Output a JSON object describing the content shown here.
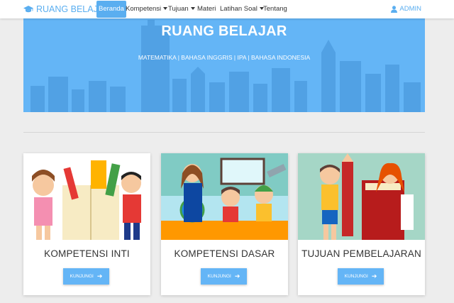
{
  "brand": {
    "name": "RUANG BELAJAR",
    "icon": "graduation-cap-icon"
  },
  "nav": {
    "items": [
      {
        "label": "Beranda",
        "active": true,
        "dropdown": false
      },
      {
        "label": "Kompetensi",
        "active": false,
        "dropdown": true
      },
      {
        "label": "Tujuan",
        "active": false,
        "dropdown": true
      },
      {
        "label": "Materi",
        "active": false,
        "dropdown": false
      },
      {
        "label": "Latihan Soal",
        "active": false,
        "dropdown": true
      },
      {
        "label": "Tentang",
        "active": false,
        "dropdown": false
      }
    ],
    "user": {
      "label": "ADMIN",
      "icon": "user-icon"
    }
  },
  "hero": {
    "title": "RUANG BELAJAR",
    "subtitle": "MATEMATIKA | BAHASA INGGRIS | IPA | BAHASA INDONESIA"
  },
  "cards": [
    {
      "title": "KOMPETENSI INTI",
      "button": "KUNJUNGI",
      "image": "children-with-school-supplies-illustration"
    },
    {
      "title": "KOMPETENSI DASAR",
      "button": "KUNJUNGI",
      "image": "teacher-and-students-classroom-illustration"
    },
    {
      "title": "TUJUAN PEMBELAJARAN",
      "button": "KUNJUNGI",
      "image": "children-with-book-and-pencil-illustration"
    }
  ],
  "colors": {
    "accent": "#5aaef0",
    "hero": "#64b5f6",
    "background": "#ededed"
  }
}
